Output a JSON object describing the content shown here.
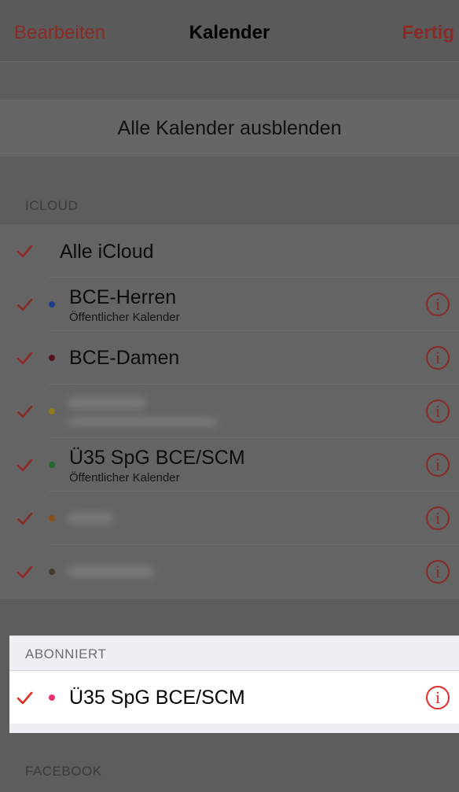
{
  "nav": {
    "left": "Bearbeiten",
    "title": "Kalender",
    "right": "Fertig"
  },
  "hide_all_button": "Alle Kalender ausblenden",
  "icloud": {
    "header": "ICLOUD",
    "all_label": "Alle iCloud",
    "calendars": [
      {
        "title": "BCE-Herren",
        "subtitle": "Öffentlicher Kalender",
        "color": "#1a3f8c",
        "blurred": false
      },
      {
        "title": "BCE-Damen",
        "subtitle": "",
        "color": "#5a0f1c",
        "blurred": false
      },
      {
        "title": "",
        "subtitle": "",
        "color": "#8f7a1c",
        "blurred": true
      },
      {
        "title": "Ü35 SpG BCE/SCM",
        "subtitle": "Öffentlicher Kalender",
        "color": "#1f6b2c",
        "blurred": false
      },
      {
        "title": "",
        "subtitle": "",
        "color": "#8a4f17",
        "blurred": true
      },
      {
        "title": "",
        "subtitle": "",
        "color": "#4a3a2a",
        "blurred": true
      }
    ]
  },
  "subscribed": {
    "header": "ABONNIERT",
    "calendar": {
      "title": "Ü35 SpG BCE/SCM",
      "color": "#ee2f6e"
    }
  },
  "facebook": {
    "header": "FACEBOOK"
  },
  "icons": {
    "check": "checkmark-icon",
    "info": "info-circle-icon",
    "info_glyph": "i"
  },
  "colors": {
    "accent": "#e62a24",
    "dim_accent": "#8a2a26"
  }
}
